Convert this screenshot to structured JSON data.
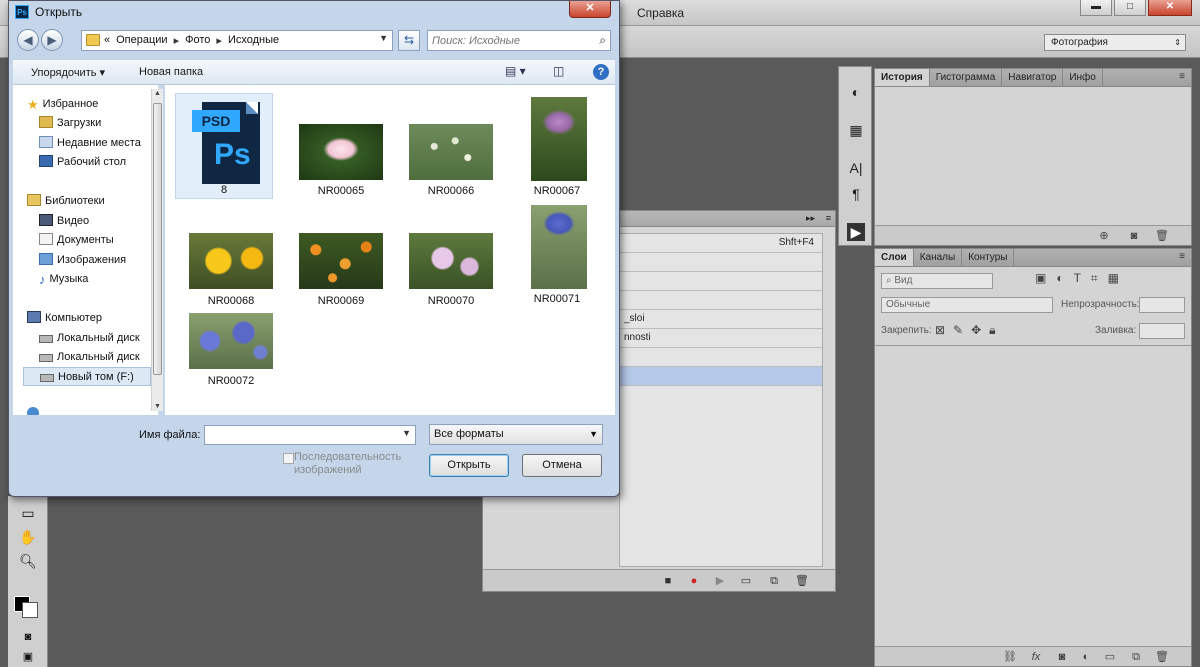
{
  "photoshop": {
    "menu_help": "Справка",
    "window_buttons": {
      "minimize": "▬",
      "maximize": "□",
      "close": "✕"
    },
    "workspace": "Фотография",
    "actions": {
      "rows": [
        {
          "label": "",
          "shortcut": "Shft+F4"
        },
        {
          "label": "",
          "shortcut": ""
        },
        {
          "label": "",
          "shortcut": ""
        },
        {
          "label": "",
          "shortcut": ""
        },
        {
          "label": "_sloi",
          "shortcut": ""
        },
        {
          "label": "nnosti",
          "shortcut": ""
        },
        {
          "label": "",
          "shortcut": ""
        },
        {
          "label": "",
          "shortcut": ""
        }
      ]
    },
    "history_tabs": [
      "История",
      "Гистограмма",
      "Навигатор",
      "Инфо"
    ],
    "layers_tabs": [
      "Слои",
      "Каналы",
      "Контуры"
    ],
    "layers": {
      "filter_placeholder": "Вид",
      "blend_mode": "Обычные",
      "opacity_label": "Непрозрачность:",
      "lock_label": "Закрепить:",
      "fill_label": "Заливка:"
    }
  },
  "dialog": {
    "title": "Открыть",
    "close": "✕",
    "breadcrumbs": [
      "«",
      "Операции",
      "▸",
      "Фото",
      "▸",
      "Исходные"
    ],
    "search_placeholder": "Поиск: Исходные",
    "toolbar": {
      "organize": "Упорядочить ▾",
      "new_folder": "Новая папка"
    },
    "nav_tree": [
      {
        "label": "Избранное",
        "icon": "star-icon"
      },
      {
        "label": "Загрузки",
        "icon": "downloads-icon"
      },
      {
        "label": "Недавние места",
        "icon": "recent-icon"
      },
      {
        "label": "Рабочий стол",
        "icon": "desktop-icon"
      },
      {
        "label": "Библиотеки",
        "icon": "library-icon"
      },
      {
        "label": "Видео",
        "icon": "video-icon"
      },
      {
        "label": "Документы",
        "icon": "documents-icon"
      },
      {
        "label": "Изображения",
        "icon": "images-icon"
      },
      {
        "label": "Музыка",
        "icon": "music-icon"
      },
      {
        "label": "Компьютер",
        "icon": "computer-icon"
      },
      {
        "label": "Локальный диск",
        "icon": "disk-icon"
      },
      {
        "label": "Локальный диск",
        "icon": "disk-icon"
      },
      {
        "label": "Новый том (F:)",
        "icon": "disk-icon"
      }
    ],
    "files": [
      {
        "name": "8",
        "type": "psd",
        "psd_tag": "PSD",
        "ps_text": "Ps"
      },
      {
        "name": "NR00065",
        "type": "image"
      },
      {
        "name": "NR00066",
        "type": "image"
      },
      {
        "name": "NR00067",
        "type": "image"
      },
      {
        "name": "NR00068",
        "type": "image"
      },
      {
        "name": "NR00069",
        "type": "image"
      },
      {
        "name": "NR00070",
        "type": "image"
      },
      {
        "name": "NR00071",
        "type": "image"
      },
      {
        "name": "NR00072",
        "type": "image"
      }
    ],
    "filename_label": "Имя файла:",
    "filename_value": "",
    "filetype": "Все форматы",
    "sequence_label": "Последовательность изображений",
    "open_button": "Открыть",
    "cancel_button": "Отмена"
  }
}
